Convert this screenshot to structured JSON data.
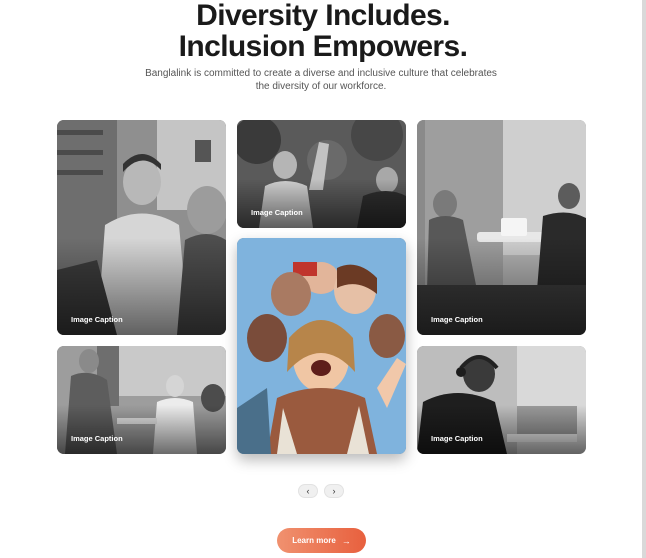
{
  "hero": {
    "title_line1": "Diversity Includes.",
    "title_line2": "Inclusion Empowers.",
    "subtitle": "Banglalink is committed to create a diverse and inclusive culture that celebrates the diversity of our workforce."
  },
  "gallery": {
    "cards": [
      {
        "caption": "Image Caption"
      },
      {
        "caption": "Image Caption"
      },
      {
        "caption": "Image Caption"
      },
      {
        "caption": "Image Caption"
      },
      {
        "caption": "Image Caption"
      }
    ]
  },
  "pager": {
    "prev_icon": "‹",
    "next_icon": "›"
  },
  "cta": {
    "label": "Learn more",
    "arrow_icon": "→"
  },
  "colors": {
    "accent_start": "#f0916f",
    "accent_end": "#e8603e"
  }
}
